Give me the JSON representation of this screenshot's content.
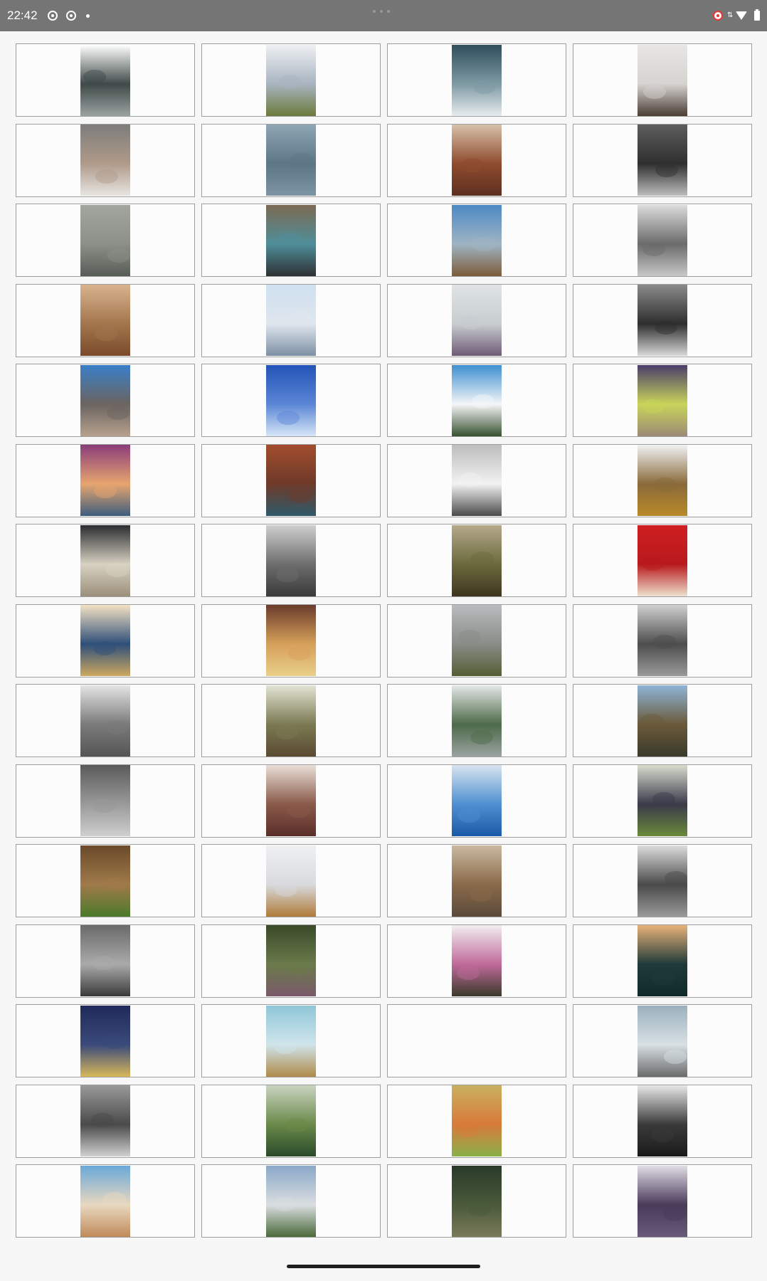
{
  "status_bar": {
    "time": "22:42",
    "left_icons": [
      "screen-record-icon",
      "screen-record-icon",
      "notification-dot-icon"
    ],
    "right_icons": [
      "record-indicator-icon",
      "data-arrows-icon",
      "wifi-icon",
      "battery-icon"
    ]
  },
  "gallery": {
    "columns": 4,
    "items": [
      {
        "name": "photo-tech-parts",
        "c1": "#ffffff",
        "c2": "#3f4a48",
        "c3": "#9aa3a0"
      },
      {
        "name": "photo-sea-coast",
        "c1": "#eef0f3",
        "c2": "#a8b4c0",
        "c3": "#6c7a3c"
      },
      {
        "name": "photo-clouds",
        "c1": "#2f4d5c",
        "c2": "#7e9aa3",
        "c3": "#e8ecee"
      },
      {
        "name": "photo-turntable",
        "c1": "#e8e6e4",
        "c2": "#d6d3d0",
        "c3": "#4a3d34"
      },
      {
        "name": "photo-cat-nose",
        "c1": "#7d7d7b",
        "c2": "#b09a8a",
        "c3": "#e7e5e1"
      },
      {
        "name": "photo-water-drops",
        "c1": "#8fa6b4",
        "c2": "#5d7686",
        "c3": "#7c94a4"
      },
      {
        "name": "photo-wood-interior",
        "c1": "#d7c1a8",
        "c2": "#8f4b2d",
        "c3": "#5d3020"
      },
      {
        "name": "photo-city-night",
        "c1": "#5d5d5d",
        "c2": "#2f2f2f",
        "c3": "#bdbdbd"
      },
      {
        "name": "photo-foggy-shore",
        "c1": "#a3a69f",
        "c2": "#8c9089",
        "c3": "#585c56"
      },
      {
        "name": "photo-vintage-car",
        "c1": "#7c6a52",
        "c2": "#4f8e9a",
        "c3": "#2e3032"
      },
      {
        "name": "photo-desert-valley",
        "c1": "#4d89c4",
        "c2": "#9fb4c4",
        "c3": "#7d5c38"
      },
      {
        "name": "photo-pier-bw",
        "c1": "#dcdcdc",
        "c2": "#6b6b6b",
        "c3": "#c8c8c8"
      },
      {
        "name": "photo-laptop-desk",
        "c1": "#d8b38e",
        "c2": "#a3764d",
        "c3": "#7a4a2b"
      },
      {
        "name": "photo-santorini",
        "c1": "#cfe0ef",
        "c2": "#dfe6ee",
        "c3": "#7d8fa3"
      },
      {
        "name": "photo-hand-bird",
        "c1": "#dfe3e3",
        "c2": "#c8cdd0",
        "c3": "#6e5a74"
      },
      {
        "name": "photo-beach-bw",
        "c1": "#8a8a8a",
        "c2": "#2e2e2e",
        "c3": "#d8d8d8"
      },
      {
        "name": "photo-empty-road",
        "c1": "#3a7fc9",
        "c2": "#6b6460",
        "c3": "#b7a18d"
      },
      {
        "name": "photo-blue-smoke",
        "c1": "#2354b8",
        "c2": "#5b86d6",
        "c3": "#d7e6f7"
      },
      {
        "name": "photo-mountain-sky",
        "c1": "#3e8fd0",
        "c2": "#f4f6f8",
        "c3": "#37502f"
      },
      {
        "name": "photo-leaf-wood",
        "c1": "#4a3d6a",
        "c2": "#c8d45a",
        "c3": "#9c8a76"
      },
      {
        "name": "photo-bokeh",
        "c1": "#8a3c7a",
        "c2": "#e7a56f",
        "c3": "#3d5d7d"
      },
      {
        "name": "photo-city-street",
        "c1": "#a24d2d",
        "c2": "#6e3a2a",
        "c3": "#2f5a6a"
      },
      {
        "name": "photo-lighthouse",
        "c1": "#bdbdbd",
        "c2": "#f2f2f2",
        "c3": "#4a4a4a"
      },
      {
        "name": "photo-fence-field",
        "c1": "#f1f2f4",
        "c2": "#8a6a3a",
        "c3": "#b98a2a"
      },
      {
        "name": "photo-retro-radio",
        "c1": "#2a2d30",
        "c2": "#d8d2c2",
        "c3": "#9a8f7a"
      },
      {
        "name": "photo-city-aerial",
        "c1": "#cfcfcf",
        "c2": "#6d6d6d",
        "c3": "#3a3a3a"
      },
      {
        "name": "photo-forest-hills",
        "c1": "#b5a98c",
        "c2": "#6b6a3c",
        "c3": "#3f351f"
      },
      {
        "name": "photo-coffee-cup",
        "c1": "#cf1f22",
        "c2": "#b81a1c",
        "c3": "#ede1cf"
      },
      {
        "name": "photo-woman-sunglasses",
        "c1": "#f3e2c3",
        "c2": "#2f4f7a",
        "c3": "#cda860"
      },
      {
        "name": "photo-girl-field",
        "c1": "#6a3c2c",
        "c2": "#d7a05a",
        "c3": "#e8cf8a"
      },
      {
        "name": "photo-misty-plain",
        "c1": "#b9bcbd",
        "c2": "#8a8c88",
        "c3": "#535f34"
      },
      {
        "name": "photo-mountains-bw",
        "c1": "#d0d0d0",
        "c2": "#4d4d4d",
        "c3": "#9a9a9a"
      },
      {
        "name": "photo-pier-lamp-bw",
        "c1": "#e4e4e4",
        "c2": "#7a7a7a",
        "c3": "#555555"
      },
      {
        "name": "photo-railway-bridge",
        "c1": "#e2e3d4",
        "c2": "#7b7a52",
        "c3": "#5a4a32"
      },
      {
        "name": "photo-foggy-forest",
        "c1": "#e4e8e6",
        "c2": "#4d6a4a",
        "c3": "#9aa3a0"
      },
      {
        "name": "photo-boat-shore",
        "c1": "#8fb4d8",
        "c2": "#6a5a3a",
        "c3": "#3a3a2a"
      },
      {
        "name": "photo-grass-bw",
        "c1": "#5a5a5a",
        "c2": "#9a9a9a",
        "c3": "#cfcfcf"
      },
      {
        "name": "photo-leather-shoes",
        "c1": "#e9dfd8",
        "c2": "#8a5a4a",
        "c3": "#5a2f2a"
      },
      {
        "name": "photo-ocean-city",
        "c1": "#d8e4ef",
        "c2": "#4f8fd0",
        "c3": "#1a5aa8"
      },
      {
        "name": "photo-grapes",
        "c1": "#d8dccd",
        "c2": "#3a3a4a",
        "c3": "#6a8a3a"
      },
      {
        "name": "photo-barn-door",
        "c1": "#6a4a2a",
        "c2": "#a07a4a",
        "c3": "#4a7a2a"
      },
      {
        "name": "photo-beach-pier",
        "c1": "#eef0f2",
        "c2": "#d8dadd",
        "c3": "#b07a3a"
      },
      {
        "name": "photo-old-building",
        "c1": "#c9b9a0",
        "c2": "#8a6a4a",
        "c3": "#5a4a3a"
      },
      {
        "name": "photo-winding-road-bw",
        "c1": "#dcdcdc",
        "c2": "#4a4a4a",
        "c3": "#9a9a9a"
      },
      {
        "name": "photo-pinecones-bw",
        "c1": "#6a6a6a",
        "c2": "#aaaaaa",
        "c3": "#3a3a3a"
      },
      {
        "name": "photo-tree-tunnel",
        "c1": "#3a4a2a",
        "c2": "#6a7a4a",
        "c3": "#7a5a6a"
      },
      {
        "name": "photo-cherry-blossom",
        "c1": "#f2eef0",
        "c2": "#c06a9a",
        "c3": "#3a3a2a"
      },
      {
        "name": "photo-pine-forest-dusk",
        "c1": "#e8b27a",
        "c2": "#1f3a3a",
        "c3": "#0f2a2a"
      },
      {
        "name": "photo-bridge-night",
        "c1": "#1f2a5a",
        "c2": "#3a4a7a",
        "c3": "#d8b85a"
      },
      {
        "name": "photo-tractor-field",
        "c1": "#8fc7d8",
        "c2": "#cfe4ea",
        "c3": "#b08a4a"
      },
      {
        "name": "photo-empty-placeholder",
        "c1": "",
        "c2": "",
        "c3": ""
      },
      {
        "name": "photo-lake-bench",
        "c1": "#9ab0bd",
        "c2": "#d8e0e4",
        "c3": "#6a6a6a"
      },
      {
        "name": "photo-traffic-bw",
        "c1": "#9a9a9a",
        "c2": "#4a4a4a",
        "c3": "#d0d0d0"
      },
      {
        "name": "photo-grass-sky",
        "c1": "#c9d3c0",
        "c2": "#6a8a4a",
        "c3": "#2a4a2a"
      },
      {
        "name": "photo-pencils",
        "c1": "#c9b060",
        "c2": "#d87a3a",
        "c3": "#8ab04a"
      },
      {
        "name": "photo-camera-hands",
        "c1": "#e8e8e8",
        "c2": "#3a3a3a",
        "c3": "#1a1a1a"
      },
      {
        "name": "photo-pebble-beach",
        "c1": "#6aa8d8",
        "c2": "#e8d8c0",
        "c3": "#c08a5a"
      },
      {
        "name": "photo-meadow-sky",
        "c1": "#8aa8c8",
        "c2": "#dadde0",
        "c3": "#4a6a3a"
      },
      {
        "name": "photo-dark-trees",
        "c1": "#2a3a2a",
        "c2": "#4a5a3a",
        "c3": "#7a7a5a"
      },
      {
        "name": "photo-purple-tree",
        "c1": "#e0dde4",
        "c2": "#4a3a5a",
        "c3": "#6a5a7a"
      }
    ]
  }
}
